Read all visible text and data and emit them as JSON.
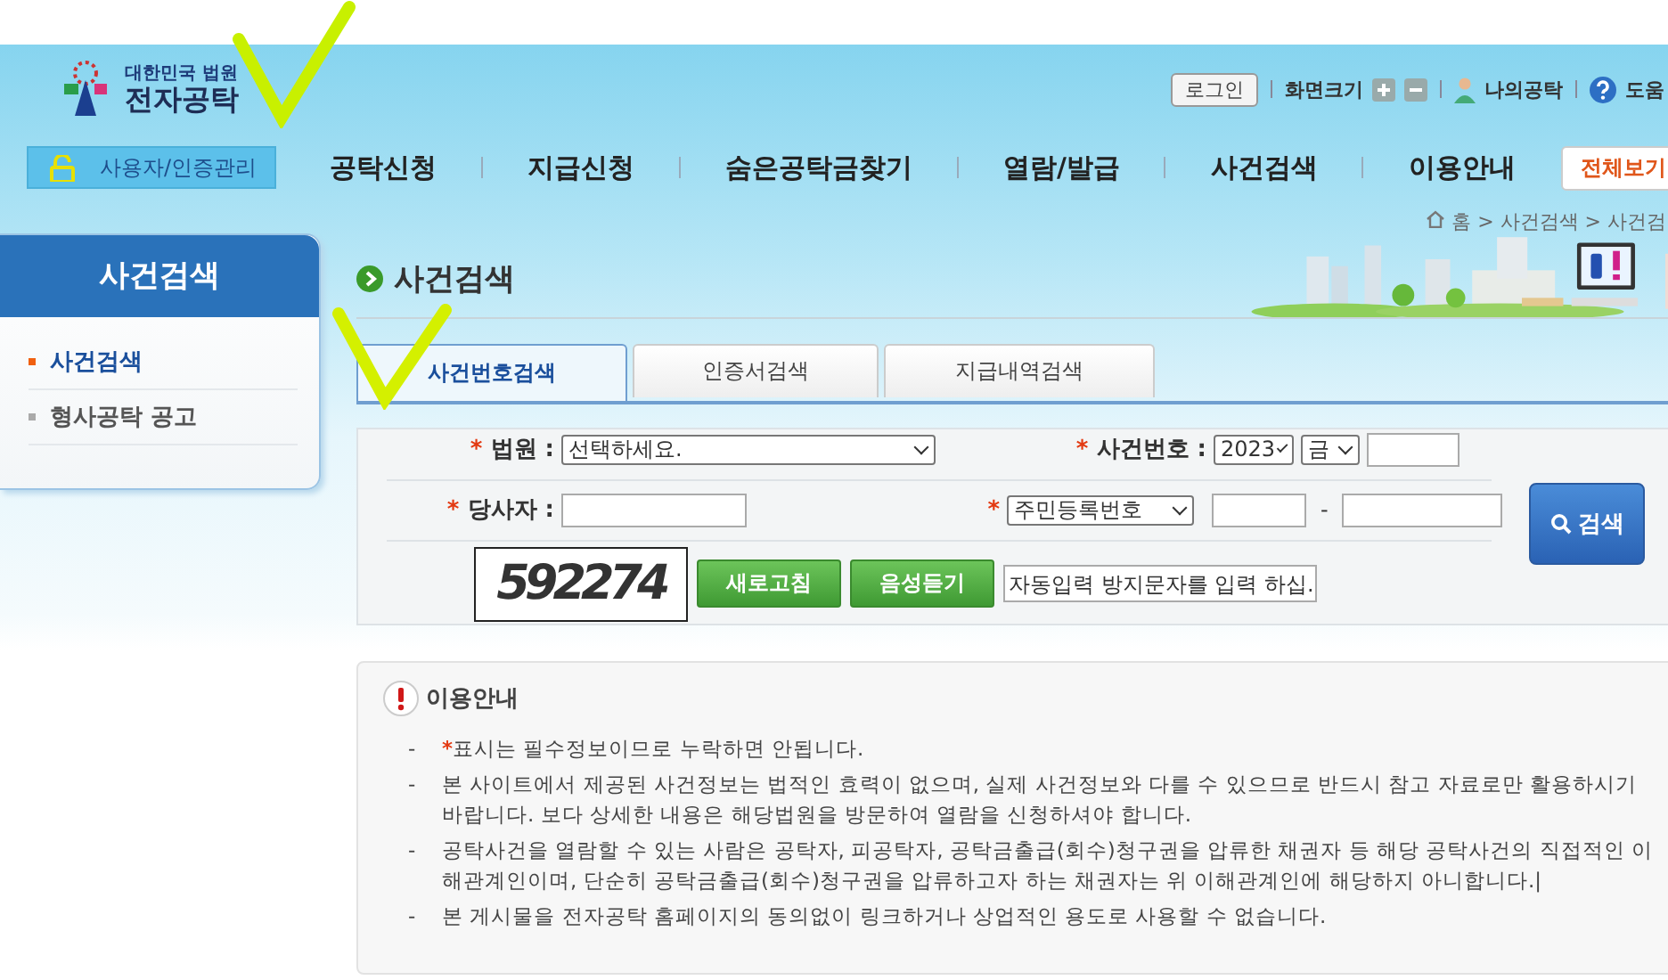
{
  "header": {
    "logo_subtitle": "대한민국 법원",
    "logo_title": "전자공탁",
    "login": "로그인",
    "font_size": "화면크기",
    "my_page": "나의공탁",
    "help": "도움"
  },
  "nav": {
    "user_button": "사용자/인증관리",
    "items": [
      "공탁신청",
      "지급신청",
      "숨은공탁금찾기",
      "열람/발급",
      "사건검색",
      "이용안내"
    ],
    "all_button": "전체보기"
  },
  "sidebar": {
    "title": "사건검색",
    "items": [
      {
        "label": "사건검색",
        "selected": true
      },
      {
        "label": "형사공탁 공고",
        "selected": false
      }
    ]
  },
  "breadcrumb": "홈 > 사건검색 > 사건검",
  "page_title": "사건검색",
  "tabs": [
    {
      "label": "사건번호검색",
      "selected": true
    },
    {
      "label": "인증서검색",
      "selected": false
    },
    {
      "label": "지급내역검색",
      "selected": false
    }
  ],
  "form": {
    "court": {
      "mark": "*",
      "label": "법원 :",
      "value": "선택하세요."
    },
    "case_number": {
      "mark": "*",
      "label": "사건번호 :",
      "year": "2023",
      "type": "금"
    },
    "party": {
      "mark": "*",
      "label": "당사자 :",
      "id_mark": "*",
      "id_type": "주민등록번호",
      "separator": "-"
    },
    "captcha": {
      "text": "592274",
      "refresh": "새로고침",
      "listen": "음성듣기",
      "placeholder": "자동입력 방지문자를 입력 하십."
    },
    "search": "검색"
  },
  "info": {
    "title": "이용안내",
    "items": [
      {
        "marker": "-",
        "mark": "*",
        "text": "표시는 필수정보이므로 누락하면 안됩니다."
      },
      {
        "marker": "-",
        "text": "본 사이트에서 제공된 사건정보는 법적인 효력이 없으며, 실제 사건정보와 다를 수 있으므로 반드시 참고 자료로만 활용하시기 바랍니다. 보다 상세한 내용은 해당법원을 방문하여 열람을 신청하셔야 합니다."
      },
      {
        "marker": "-",
        "text": "공탁사건을 열람할 수 있는 사람은 공탁자, 피공탁자, 공탁금출급(회수)청구권을 압류한 채권자 등 해당 공탁사건의 직접적인 이해관계인이며, 단순히 공탁금출급(회수)청구권을 압류하고자 하는 채권자는 위 이해관계인에 해당하지 아니합니다.|"
      },
      {
        "marker": "-",
        "text": "본 게시물을 전자공탁 홈페이지의 동의없이 링크하거나 상업적인 용도로 사용할 수 없습니다."
      }
    ]
  }
}
